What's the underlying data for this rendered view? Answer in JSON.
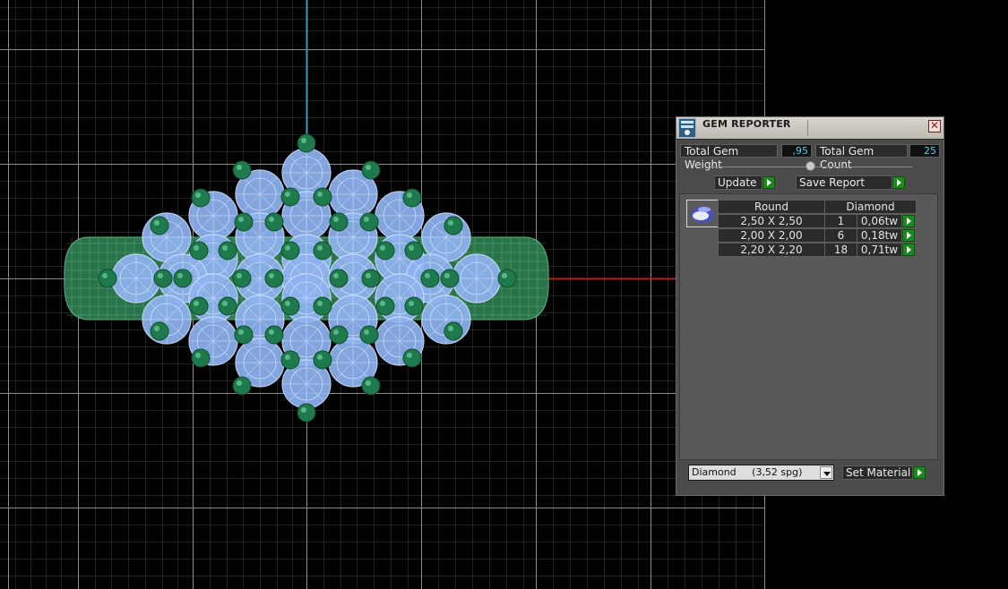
{
  "panel": {
    "title": "GEM REPORTER",
    "close_glyph": "✕",
    "total_weight_label": "Total Gem Weight",
    "total_weight_value": ",95",
    "total_count_label": "Total Gem Count",
    "total_count_value": "25",
    "update_label": "Update",
    "save_report_label": "Save Report",
    "table": {
      "shape_header": "Round",
      "material_header": "Diamond",
      "rows": [
        {
          "size": "2,50 X 2,50",
          "count": "1",
          "weight": "0,06tw"
        },
        {
          "size": "2,00 X 2,00",
          "count": "6",
          "weight": "0,18tw"
        },
        {
          "size": "2,20 X 2,20",
          "count": "18",
          "weight": "0,71tw"
        }
      ]
    },
    "material_select_value": "Diamond     (3,52 spg)",
    "set_material_label": "Set Material"
  },
  "colors": {
    "grid": "#8c8c8c",
    "axis_y": "#2aa3b8",
    "axis_x": "#c41a1a",
    "prong": "#1e7a4c",
    "gem": "#8fb3f0",
    "band": "#2d7a4e"
  },
  "icons": {
    "panel_icon": "gem-reporter-icon",
    "close": "close-icon",
    "update_arrow": "play-arrow-icon",
    "save_arrow": "play-arrow-icon",
    "dropdown": "chevron-down-icon"
  }
}
